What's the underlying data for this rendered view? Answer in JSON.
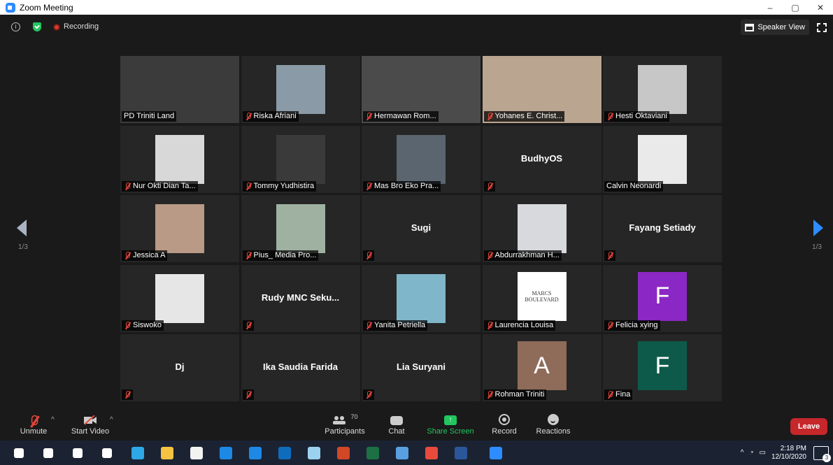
{
  "window": {
    "title": "Zoom Meeting",
    "min": "–",
    "restore": "▢",
    "close": "✕"
  },
  "topbar": {
    "recording_label": "Recording",
    "speaker_view_label": "Speaker View"
  },
  "pager": {
    "left": "1/3",
    "right": "1/3"
  },
  "tiles": [
    {
      "name": "PD Triniti Land",
      "muted": false,
      "active": true,
      "kind": "video",
      "color": "#3b3b3b"
    },
    {
      "name": "Riska Afriani",
      "muted": true,
      "kind": "video",
      "color": "#8a9aa6"
    },
    {
      "name": "Hermawan Rom...",
      "muted": true,
      "kind": "video",
      "color": "#4b4b4b"
    },
    {
      "name": "Yohanes E. Christ...",
      "muted": true,
      "kind": "video",
      "color": "#b9a590"
    },
    {
      "name": "Hesti Oktaviani",
      "muted": true,
      "kind": "video",
      "color": "#c7c7c7"
    },
    {
      "name": "Nur Okti Dian Ta...",
      "muted": true,
      "kind": "video",
      "color": "#d8d8d8"
    },
    {
      "name": "Tommy Yudhistira",
      "muted": true,
      "kind": "video",
      "color": "#3a3a3a"
    },
    {
      "name": "Mas Bro Eko Pra...",
      "muted": true,
      "kind": "video",
      "color": "#5a6570"
    },
    {
      "name": "",
      "display": "BudhyOS",
      "muted": true,
      "kind": "name"
    },
    {
      "name": "Calvin Neonardi",
      "muted": false,
      "kind": "video",
      "color": "#eaeaea"
    },
    {
      "name": "Jessica A",
      "muted": true,
      "kind": "video",
      "color": "#b99a86"
    },
    {
      "name": "Pius_ Media Pro...",
      "muted": true,
      "kind": "video",
      "color": "#9fb2a2"
    },
    {
      "name": "",
      "display": "Sugi",
      "muted": true,
      "kind": "name"
    },
    {
      "name": "Abdurrakhman H...",
      "muted": true,
      "kind": "video",
      "color": "#d7d9dc"
    },
    {
      "name": "",
      "display": "Fayang Setiady",
      "muted": true,
      "kind": "name"
    },
    {
      "name": "Siswoko",
      "muted": true,
      "kind": "video",
      "color": "#e6e6e6"
    },
    {
      "name": "",
      "display": "Rudy MNC Seku...",
      "muted": true,
      "kind": "name"
    },
    {
      "name": "Yanita Petriella",
      "muted": true,
      "kind": "video",
      "color": "#7fb6c9"
    },
    {
      "name": "Laurencia Louisa",
      "muted": true,
      "kind": "logo",
      "color": "#ffffff",
      "logo_line1": "MARCS",
      "logo_line2": "BOULEVARD"
    },
    {
      "name": "Felicia xying",
      "muted": true,
      "kind": "letter",
      "letter": "F",
      "color": "#8b27c4"
    },
    {
      "name": "",
      "display": "Dj",
      "muted": true,
      "kind": "name"
    },
    {
      "name": "",
      "display": "Ika Saudia Farida",
      "muted": true,
      "kind": "name"
    },
    {
      "name": "",
      "display": "Lia Suryani",
      "muted": true,
      "kind": "name"
    },
    {
      "name": "Rohman Triniti",
      "muted": true,
      "kind": "letter",
      "letter": "A",
      "color": "#8f6b5a"
    },
    {
      "name": "Fina",
      "muted": true,
      "kind": "letter",
      "letter": "F",
      "color": "#0e5a4a"
    }
  ],
  "toolbar": {
    "unmute": "Unmute",
    "start_video": "Start Video",
    "participants": "Participants",
    "participants_count": "70",
    "chat": "Chat",
    "share_screen": "Share Screen",
    "record": "Record",
    "reactions": "Reactions",
    "leave": "Leave"
  },
  "taskbar": {
    "time": "2:18 PM",
    "date": "12/10/2020",
    "notifications": "3",
    "apps": [
      "windows-start",
      "search",
      "cortana",
      "task-view",
      "edge",
      "file-explorer",
      "store",
      "l-app",
      "mail",
      "outlook",
      "paint",
      "powerpoint",
      "excel",
      "notes",
      "chrome",
      "word",
      "zoom"
    ]
  }
}
